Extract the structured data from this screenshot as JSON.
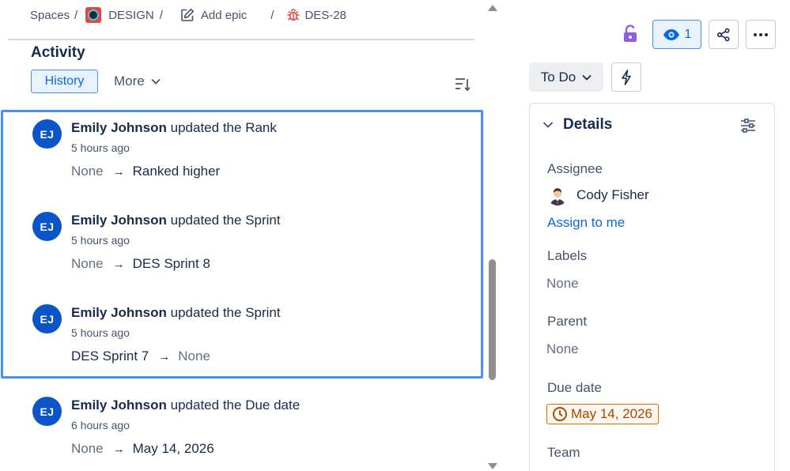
{
  "breadcrumb": {
    "spaces": "Spaces",
    "separator": "/",
    "project": "DESIGN",
    "add_epic": "Add epic",
    "issue_key": "DES-28"
  },
  "activity": {
    "title": "Activity",
    "tab_history": "History",
    "tab_more": "More",
    "entries": [
      {
        "initials": "EJ",
        "user": "Emily Johnson",
        "action": " updated the ",
        "field": "Rank",
        "time": "5 hours ago",
        "from": "None",
        "to": "Ranked higher"
      },
      {
        "initials": "EJ",
        "user": "Emily Johnson",
        "action": " updated the ",
        "field": "Sprint",
        "time": "5 hours ago",
        "from": "None",
        "to": "DES Sprint 8"
      },
      {
        "initials": "EJ",
        "user": "Emily Johnson",
        "action": " updated the ",
        "field": "Sprint",
        "time": "5 hours ago",
        "from": "DES Sprint 7",
        "to": "None"
      },
      {
        "initials": "EJ",
        "user": "Emily Johnson",
        "action": " updated the ",
        "field": "Due date",
        "time": "6 hours ago",
        "from": "None",
        "to": "May 14, 2026"
      }
    ]
  },
  "toolbar": {
    "watch_count": "1"
  },
  "status": {
    "label": "To Do"
  },
  "details": {
    "title": "Details",
    "assignee_label": "Assignee",
    "assignee_name": "Cody Fisher",
    "assign_to_me": "Assign to me",
    "labels_label": "Labels",
    "labels_value": "None",
    "parent_label": "Parent",
    "parent_value": "None",
    "due_date_label": "Due date",
    "due_date_value": "May 14, 2026",
    "team_label": "Team"
  },
  "colors": {
    "accent_blue": "#0c66e4",
    "selection_border": "#4c8ef7",
    "avatar_blue": "#0c55c9",
    "due_orange": "#d97008",
    "lock_purple": "#8f5de8"
  }
}
